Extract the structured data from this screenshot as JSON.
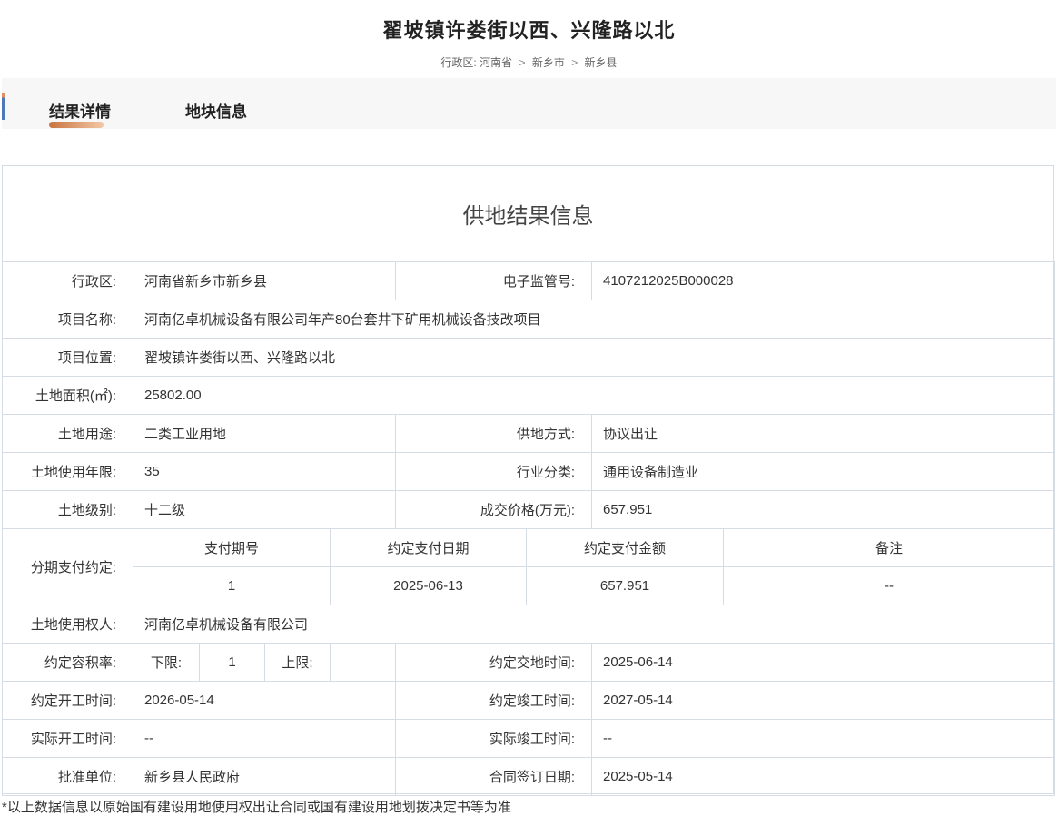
{
  "header": {
    "title": "翟坡镇许娄街以西、兴隆路以北",
    "breadcrumb_label": "行政区:",
    "breadcrumb": [
      "河南省",
      "新乡市",
      "新乡县"
    ],
    "breadcrumb_separator": ">"
  },
  "tabs": [
    {
      "label": "结果详情",
      "active": true
    },
    {
      "label": "地块信息",
      "active": false
    }
  ],
  "panel": {
    "title": "供地结果信息",
    "rows": {
      "district": {
        "label": "行政区:",
        "value": "河南省新乡市新乡县"
      },
      "supervision_no": {
        "label": "电子监管号:",
        "value": "4107212025B000028"
      },
      "project_name": {
        "label": "项目名称:",
        "value": "河南亿卓机械设备有限公司年产80台套井下矿用机械设备技改项目"
      },
      "project_location": {
        "label": "项目位置:",
        "value": "翟坡镇许娄街以西、兴隆路以北"
      },
      "land_area": {
        "label": "土地面积(㎡):",
        "value": "25802.00"
      },
      "land_use": {
        "label": "土地用途:",
        "value": "二类工业用地"
      },
      "supply_method": {
        "label": "供地方式:",
        "value": "协议出让"
      },
      "use_term": {
        "label": "土地使用年限:",
        "value": "35"
      },
      "industry": {
        "label": "行业分类:",
        "value": "通用设备制造业"
      },
      "land_level": {
        "label": "土地级别:",
        "value": "十二级"
      },
      "deal_price": {
        "label": "成交价格(万元):",
        "value": "657.951"
      },
      "installment": {
        "label": "分期支付约定:",
        "columns": [
          "支付期号",
          "约定支付日期",
          "约定支付金额",
          "备注"
        ],
        "rows": [
          [
            "1",
            "2025-06-13",
            "657.951",
            "--"
          ]
        ]
      },
      "right_holder": {
        "label": "土地使用权人:",
        "value": "河南亿卓机械设备有限公司"
      },
      "plot_ratio": {
        "label": "约定容积率:",
        "lower_label": "下限:",
        "lower_value": "1",
        "upper_label": "上限:",
        "upper_value": ""
      },
      "handover_time": {
        "label": "约定交地时间:",
        "value": "2025-06-14"
      },
      "start_time": {
        "label": "约定开工时间:",
        "value": "2026-05-14"
      },
      "finish_time": {
        "label": "约定竣工时间:",
        "value": "2027-05-14"
      },
      "actual_start": {
        "label": "实际开工时间:",
        "value": "--"
      },
      "actual_finish": {
        "label": "实际竣工时间:",
        "value": "--"
      },
      "approval_unit": {
        "label": "批准单位:",
        "value": "新乡县人民政府"
      },
      "contract_date": {
        "label": "合同签订日期:",
        "value": "2025-05-14"
      }
    }
  },
  "footnote": "*以上数据信息以原始国有建设用地使用权出让合同或国有建设用地划拨决定书等为准",
  "colors": {
    "tab_accent": "#c8743f",
    "side_accent": "#4f79b8",
    "border": "#d6dce6"
  }
}
